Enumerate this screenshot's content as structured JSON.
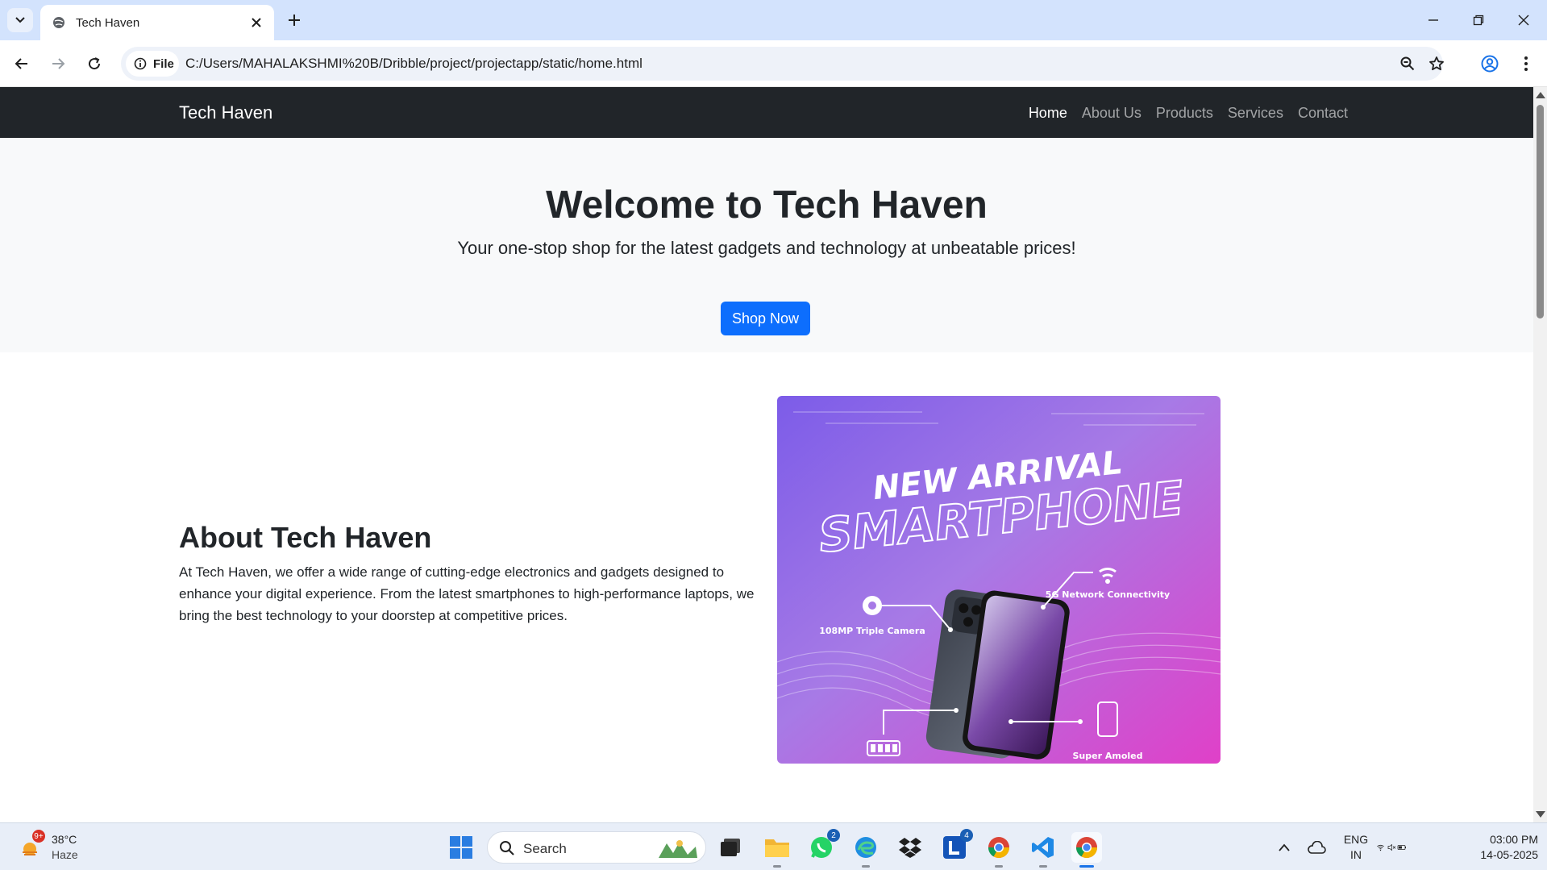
{
  "browser": {
    "tab_title": "Tech Haven",
    "site_chip_label": "File",
    "url": "C:/Users/MAHALAKSHMI%20B/Dribble/project/projectapp/static/home.html"
  },
  "site": {
    "brand": "Tech Haven",
    "nav": [
      {
        "label": "Home",
        "active": true
      },
      {
        "label": "About Us",
        "active": false
      },
      {
        "label": "Products",
        "active": false
      },
      {
        "label": "Services",
        "active": false
      },
      {
        "label": "Contact",
        "active": false
      }
    ],
    "hero": {
      "title": "Welcome to Tech Haven",
      "subtitle": "Your one-stop shop for the latest gadgets and technology at unbeatable prices!",
      "cta": "Shop Now"
    },
    "about": {
      "title": "About Tech Haven",
      "text": "At Tech Haven, we offer a wide range of cutting-edge electronics and gadgets designed to enhance your digital experience. From the latest smartphones to high-performance laptops, we bring the best technology to your doorstep at competitive prices."
    },
    "promo": {
      "line1": "NEW ARRIVAL",
      "line2": "SMARTPHONE",
      "camera": "108MP Triple Camera",
      "network": "5G Network Connectivity",
      "display": "Super Amoled"
    }
  },
  "taskbar": {
    "weather": {
      "temp": "38°C",
      "desc": "Haze",
      "badge": "9+"
    },
    "search_label": "Search",
    "whatsapp_badge": "2",
    "l_app_badge": "4",
    "language": "ENG",
    "region": "IN",
    "time": "03:00 PM",
    "date": "14-05-2025"
  },
  "colors": {
    "primary": "#0d6efd",
    "navbar": "#212529",
    "hero_bg": "#f8f9fa",
    "promo_gradient_start": "#8b5cf6",
    "promo_gradient_end": "#e040c8"
  }
}
